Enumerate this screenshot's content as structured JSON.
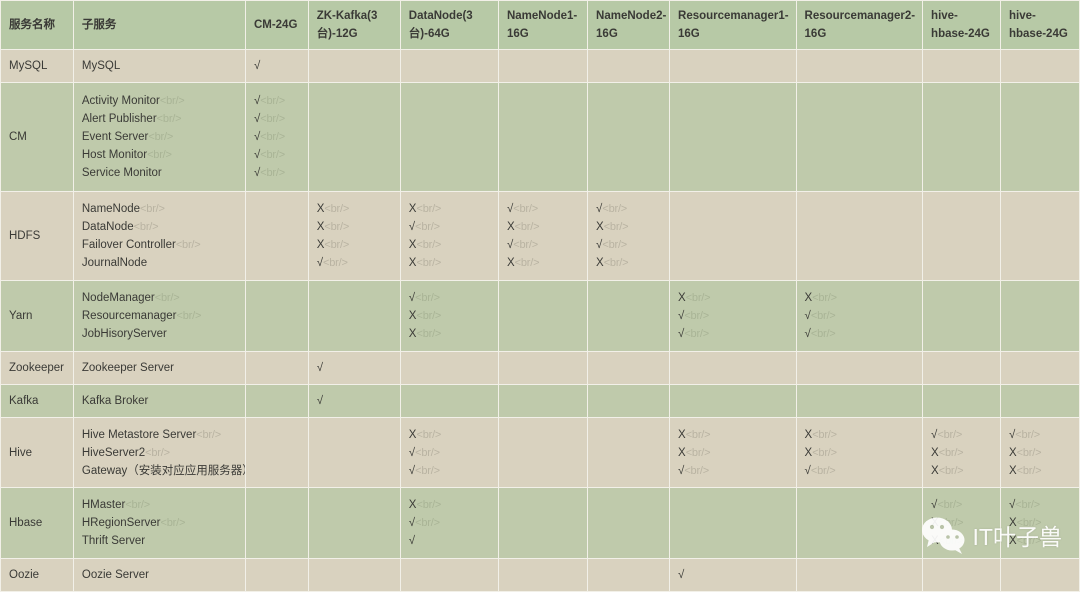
{
  "table": {
    "headers": [
      "服务名称",
      "子服务",
      "CM-24G",
      "ZK-Kafka(3台)-12G",
      "DataNode(3台)-64G",
      "NameNode1-16G",
      "NameNode2-16G",
      "Resourcemanager1-16G",
      "Resourcemanager2-16G",
      "hive-hbase-24G",
      "hive-hbase-24G"
    ],
    "rows": [
      {
        "service": "MySQL",
        "subservices": [
          {
            "text": "MySQL",
            "br": false
          }
        ],
        "cells": [
          [
            {
              "text": "√",
              "br": false
            }
          ],
          [],
          [],
          [],
          [],
          [],
          [],
          [],
          []
        ]
      },
      {
        "service": "CM",
        "subservices": [
          {
            "text": "Activity Monitor",
            "br": true
          },
          {
            "text": "Alert Publisher",
            "br": true
          },
          {
            "text": "Event Server",
            "br": true
          },
          {
            "text": "Host Monitor",
            "br": true
          },
          {
            "text": "Service Monitor",
            "br": false
          }
        ],
        "cells": [
          [
            {
              "text": "√",
              "br": true
            },
            {
              "text": "√",
              "br": true
            },
            {
              "text": "√",
              "br": true
            },
            {
              "text": "√",
              "br": true
            },
            {
              "text": "√",
              "br": true
            }
          ],
          [],
          [],
          [],
          [],
          [],
          [],
          [],
          []
        ]
      },
      {
        "service": "HDFS",
        "subservices": [
          {
            "text": "NameNode",
            "br": true
          },
          {
            "text": "DataNode",
            "br": true
          },
          {
            "text": "Failover Controller",
            "br": true
          },
          {
            "text": "JournalNode",
            "br": false
          }
        ],
        "cells": [
          [],
          [
            {
              "text": "X",
              "br": true
            },
            {
              "text": "X",
              "br": true
            },
            {
              "text": "X",
              "br": true
            },
            {
              "text": "√",
              "br": true
            }
          ],
          [
            {
              "text": "X",
              "br": true
            },
            {
              "text": "√",
              "br": true
            },
            {
              "text": "X",
              "br": true
            },
            {
              "text": "X",
              "br": true
            }
          ],
          [
            {
              "text": "√",
              "br": true
            },
            {
              "text": "X",
              "br": true
            },
            {
              "text": "√",
              "br": true
            },
            {
              "text": "X",
              "br": true
            }
          ],
          [
            {
              "text": "√",
              "br": true
            },
            {
              "text": "X",
              "br": true
            },
            {
              "text": "√",
              "br": true
            },
            {
              "text": "X",
              "br": true
            }
          ],
          [],
          [],
          [],
          []
        ]
      },
      {
        "service": "Yarn",
        "subservices": [
          {
            "text": "NodeManager",
            "br": true
          },
          {
            "text": "Resourcemanager",
            "br": true
          },
          {
            "text": "JobHisoryServer",
            "br": false
          }
        ],
        "cells": [
          [],
          [],
          [
            {
              "text": "√",
              "br": true
            },
            {
              "text": "X",
              "br": true
            },
            {
              "text": "X",
              "br": true
            }
          ],
          [],
          [],
          [
            {
              "text": "X",
              "br": true
            },
            {
              "text": "√",
              "br": true
            },
            {
              "text": "√",
              "br": true
            }
          ],
          [
            {
              "text": "X",
              "br": true
            },
            {
              "text": "√",
              "br": true
            },
            {
              "text": "√",
              "br": true
            }
          ],
          [],
          []
        ]
      },
      {
        "service": "Zookeeper",
        "subservices": [
          {
            "text": "Zookeeper Server",
            "br": false
          }
        ],
        "cells": [
          [],
          [
            {
              "text": "√",
              "br": false
            }
          ],
          [],
          [],
          [],
          [],
          [],
          [],
          []
        ]
      },
      {
        "service": "Kafka",
        "subservices": [
          {
            "text": "Kafka Broker",
            "br": false
          }
        ],
        "cells": [
          [],
          [
            {
              "text": "√",
              "br": false
            }
          ],
          [],
          [],
          [],
          [],
          [],
          [],
          []
        ]
      },
      {
        "service": "Hive",
        "subservices": [
          {
            "text": "Hive Metastore Server",
            "br": true
          },
          {
            "text": "HiveServer2",
            "br": true
          },
          {
            "text": "Gateway（安装对应应用服务器）",
            "br": false
          }
        ],
        "cells": [
          [],
          [],
          [
            {
              "text": "X",
              "br": true
            },
            {
              "text": "√",
              "br": true
            },
            {
              "text": "√",
              "br": true
            }
          ],
          [],
          [],
          [
            {
              "text": "X",
              "br": true
            },
            {
              "text": "X",
              "br": true
            },
            {
              "text": "√",
              "br": true
            }
          ],
          [
            {
              "text": "X",
              "br": true
            },
            {
              "text": "X",
              "br": true
            },
            {
              "text": "√",
              "br": true
            }
          ],
          [
            {
              "text": "√",
              "br": true
            },
            {
              "text": "X",
              "br": true
            },
            {
              "text": "X",
              "br": true
            }
          ],
          [
            {
              "text": "√",
              "br": true
            },
            {
              "text": "X",
              "br": true
            },
            {
              "text": "X",
              "br": true
            }
          ]
        ]
      },
      {
        "service": "Hbase",
        "subservices": [
          {
            "text": "HMaster",
            "br": true
          },
          {
            "text": "HRegionServer",
            "br": true
          },
          {
            "text": "Thrift Server",
            "br": false
          }
        ],
        "cells": [
          [],
          [],
          [
            {
              "text": "X",
              "br": true
            },
            {
              "text": "√",
              "br": true
            },
            {
              "text": "√",
              "br": false
            }
          ],
          [],
          [],
          [],
          [],
          [
            {
              "text": "√",
              "br": true
            },
            {
              "text": "X",
              "br": true
            },
            {
              "text": "X",
              "br": true
            }
          ],
          [
            {
              "text": "√",
              "br": true
            },
            {
              "text": "X",
              "br": true
            },
            {
              "text": "X",
              "br": true
            }
          ]
        ]
      },
      {
        "service": "Oozie",
        "subservices": [
          {
            "text": "Oozie Server",
            "br": false
          }
        ],
        "cells": [
          [],
          [],
          [],
          [],
          [],
          [
            {
              "text": "√",
              "br": false
            }
          ],
          [],
          [],
          []
        ]
      }
    ]
  },
  "watermark": {
    "text": "IT叶子兽",
    "icon": "wechat-icon"
  },
  "colors": {
    "header_bg": "#b7c9a6",
    "row_beige": "#d9d2bf",
    "row_green": "#bfcaab",
    "border": "#f2f0e8",
    "text": "#3a3a36",
    "brtag": "#b9b3a2"
  }
}
